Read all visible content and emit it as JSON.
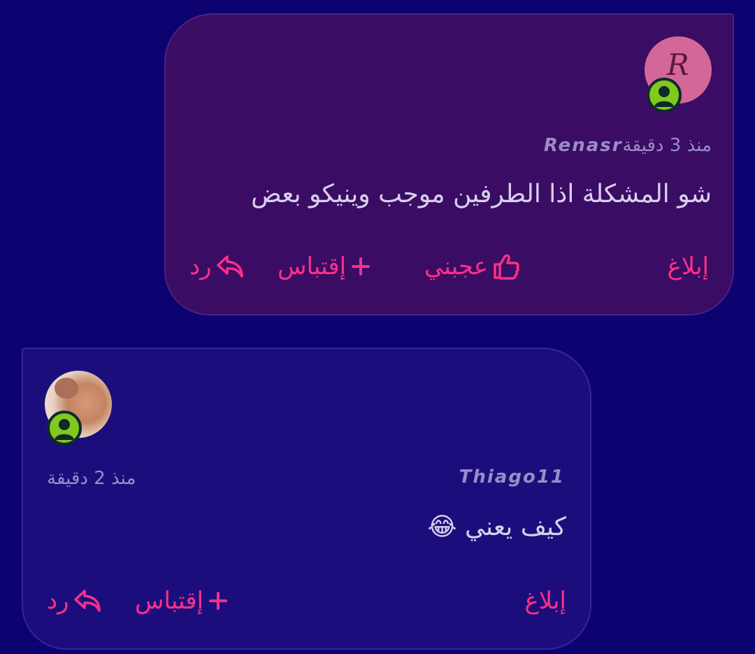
{
  "comments": [
    {
      "avatar_letter": "R",
      "username": "Renasr",
      "time": "منذ 3 دقيقة",
      "text": "شو المشكلة اذا الطرفين موجب وينيكو بعض",
      "report_label": "إبلاغ",
      "like_label": "عجبني",
      "quote_label": "إقتباس",
      "reply_label": "رد"
    },
    {
      "username": "Thiago11",
      "time": "منذ 2 دقيقة",
      "text": "كيف يعني 😂",
      "report_label": "إبلاغ",
      "quote_label": "إقتباس",
      "reply_label": "رد"
    }
  ],
  "colors": {
    "background": "#0c0270",
    "card1_bg": "#3a0c63",
    "card2_bg": "#1b0e7c",
    "accent": "#ff2f8a",
    "online_status": "#82c91e",
    "avatar_pink": "#d4679a"
  },
  "icons": [
    "user-online-icon",
    "thumbs-up-icon",
    "plus-icon",
    "reply-arrow-icon"
  ]
}
